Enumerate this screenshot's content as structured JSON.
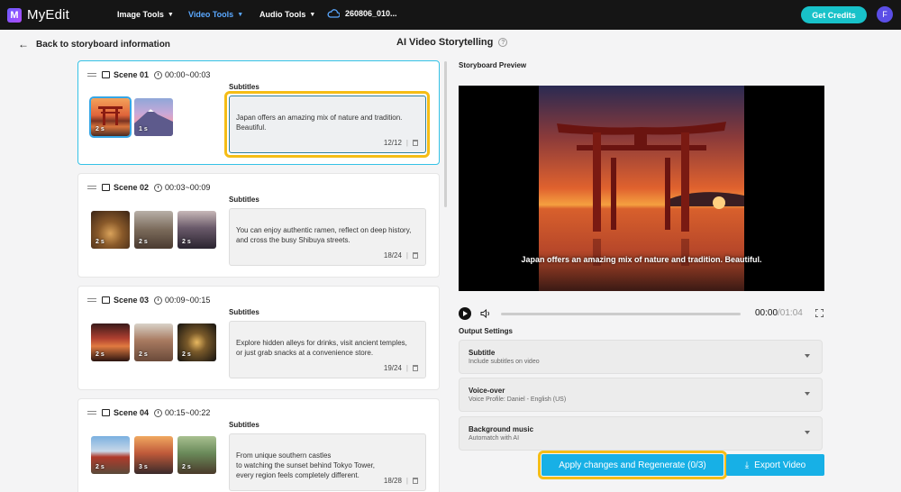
{
  "topbar": {
    "app_name": "MyEdit",
    "nav": [
      {
        "label": "Image Tools"
      },
      {
        "label": "Video Tools"
      },
      {
        "label": "Audio Tools"
      }
    ],
    "cloud_file": "260806_010...",
    "get_credits": "Get Credits",
    "avatar_initial": "F"
  },
  "header": {
    "back_label": "Back to storyboard information",
    "title": "AI Video Storytelling",
    "help_icon": "?"
  },
  "scenes": [
    {
      "name": "Scene 01",
      "time": "00:00~00:03",
      "subtitles_label": "Subtitles",
      "text": "Japan offers an amazing mix of nature and tradition.\nBeautiful.",
      "count": "12/12",
      "thumbs": [
        {
          "dur": "2 s"
        },
        {
          "dur": "1 s"
        }
      ]
    },
    {
      "name": "Scene 02",
      "time": "00:03~00:09",
      "subtitles_label": "Subtitles",
      "text": "You can enjoy authentic ramen, reflect on deep history,\nand cross the busy Shibuya streets.",
      "count": "18/24",
      "thumbs": [
        {
          "dur": "2 s"
        },
        {
          "dur": "2 s"
        },
        {
          "dur": "2 s"
        }
      ]
    },
    {
      "name": "Scene 03",
      "time": "00:09~00:15",
      "subtitles_label": "Subtitles",
      "text": "Explore hidden alleys for drinks, visit ancient temples,\nor just grab snacks at a convenience store.",
      "count": "19/24",
      "thumbs": [
        {
          "dur": "2 s"
        },
        {
          "dur": "2 s"
        },
        {
          "dur": "2 s"
        }
      ]
    },
    {
      "name": "Scene 04",
      "time": "00:15~00:22",
      "subtitles_label": "Subtitles",
      "text": "From unique southern castles\nto watching the sunset behind Tokyo Tower,\nevery region feels completely different.",
      "count": "18/28",
      "thumbs": [
        {
          "dur": "2 s"
        },
        {
          "dur": "3 s"
        },
        {
          "dur": "2 s"
        }
      ]
    }
  ],
  "preview": {
    "label": "Storyboard Preview",
    "caption": "Japan offers an amazing mix of nature and tradition. Beautiful.",
    "time_current": "00:00",
    "time_total": "/01:04",
    "progress": 0
  },
  "output": {
    "label": "Output Settings",
    "items": [
      {
        "title": "Subtitle",
        "desc": "Include subtitles on video"
      },
      {
        "title": "Voice-over",
        "desc": "Voice Profile: Daniel - English (US)"
      },
      {
        "title": "Background music",
        "desc": "Automatch with AI"
      }
    ]
  },
  "actions": {
    "apply": "Apply changes and Regenerate (0/3)",
    "export": "Export Video"
  },
  "colors": {
    "accent": "#17b0e6",
    "highlight": "#f5bd16",
    "topbar": "#151515",
    "credits": "#18c2c9"
  }
}
